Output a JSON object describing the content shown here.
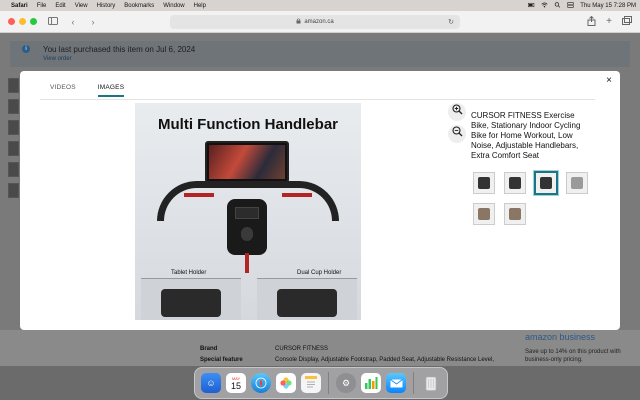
{
  "menubar": {
    "apple": "",
    "items": [
      "Safari",
      "File",
      "Edit",
      "View",
      "History",
      "Bookmarks",
      "Window",
      "Help"
    ],
    "datetime": "Thu May 15  7:28 PM"
  },
  "browser": {
    "url": "amazon.ca",
    "back_glyph": "‹",
    "forward_glyph": "›"
  },
  "banner": {
    "message": "You last purchased this item on Jul 6, 2024",
    "view_order": "View order"
  },
  "modal": {
    "tabs": [
      {
        "label": "VIDEOS",
        "active": false
      },
      {
        "label": "IMAGES",
        "active": true
      }
    ],
    "close_glyph": "×",
    "main_image": {
      "headline": "Multi Function Handlebar",
      "caption_left": "Tablet Holder",
      "caption_right": "Dual Cup Holder"
    },
    "zoom_in": "+",
    "zoom_out": "−",
    "product_title": "CURSOR FITNESS Exercise Bike, Stationary Indoor Cycling Bike for Home Workout, Low Noise, Adjustable Handlebars, Extra Comfort Seat",
    "selected_thumbnail_index": 2
  },
  "specs": [
    {
      "label": "Brand",
      "value": "CURSOR FITNESS"
    },
    {
      "label": "Special feature",
      "value": "Console Display, Adjustable Footstrap, Padded Seat, Adjustable Resistance Level,"
    }
  ],
  "amazon_business": {
    "logo": "amazon business",
    "save_text": "Save up to 14% on this product with business-only pricing."
  },
  "dock": {
    "calendar_month": "MAY",
    "calendar_day": "15"
  }
}
